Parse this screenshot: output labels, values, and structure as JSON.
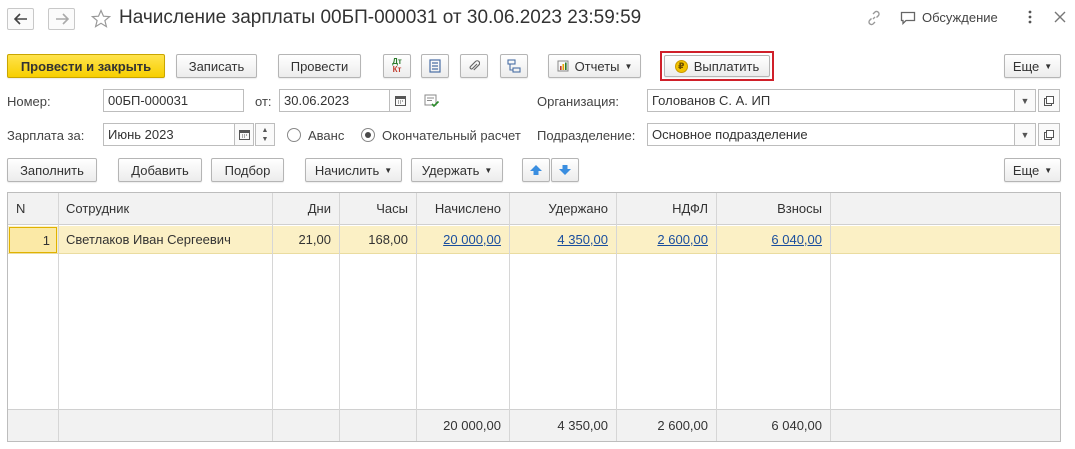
{
  "window": {
    "title": "Начисление зарплаты 00БП-000031 от 30.06.2023 23:59:59",
    "discussion_label": "Обсуждение"
  },
  "toolbar": {
    "post_close": "Провести и закрыть",
    "save": "Записать",
    "post": "Провести",
    "dtkt_dt": "Дт",
    "dtkt_kt": "Кт",
    "reports": "Отчеты",
    "pay": "Выплатить",
    "more": "Еще"
  },
  "form": {
    "number_label": "Номер:",
    "number_value": "00БП-000031",
    "date_label": "от:",
    "date_value": "30.06.2023",
    "org_label": "Организация:",
    "org_value": "Голованов С. А. ИП",
    "salary_for_label": "Зарплата за:",
    "salary_for_value": "Июнь 2023",
    "advance_label": "Аванс",
    "final_label": "Окончательный расчет",
    "division_label": "Подразделение:",
    "division_value": "Основное подразделение"
  },
  "table_toolbar": {
    "fill": "Заполнить",
    "add": "Добавить",
    "selection": "Подбор",
    "accrue": "Начислить",
    "withhold": "Удержать",
    "more": "Еще"
  },
  "table": {
    "columns": [
      "N",
      "Сотрудник",
      "Дни",
      "Часы",
      "Начислено",
      "Удержано",
      "НДФЛ",
      "Взносы"
    ],
    "rows": [
      {
        "n": "1",
        "employee": "Светлаков Иван Сергеевич",
        "days": "21,00",
        "hours": "168,00",
        "accrued": "20 000,00",
        "withheld": "4 350,00",
        "ndfl": "2 600,00",
        "contributions": "6 040,00"
      }
    ],
    "totals": {
      "accrued": "20 000,00",
      "withheld": "4 350,00",
      "ndfl": "2 600,00",
      "contributions": "6 040,00"
    }
  },
  "colors": {
    "primary": "#f7cf00",
    "highlight": "#d0202a",
    "selected_row": "#fbf0c5",
    "link": "#1a4e9e"
  }
}
